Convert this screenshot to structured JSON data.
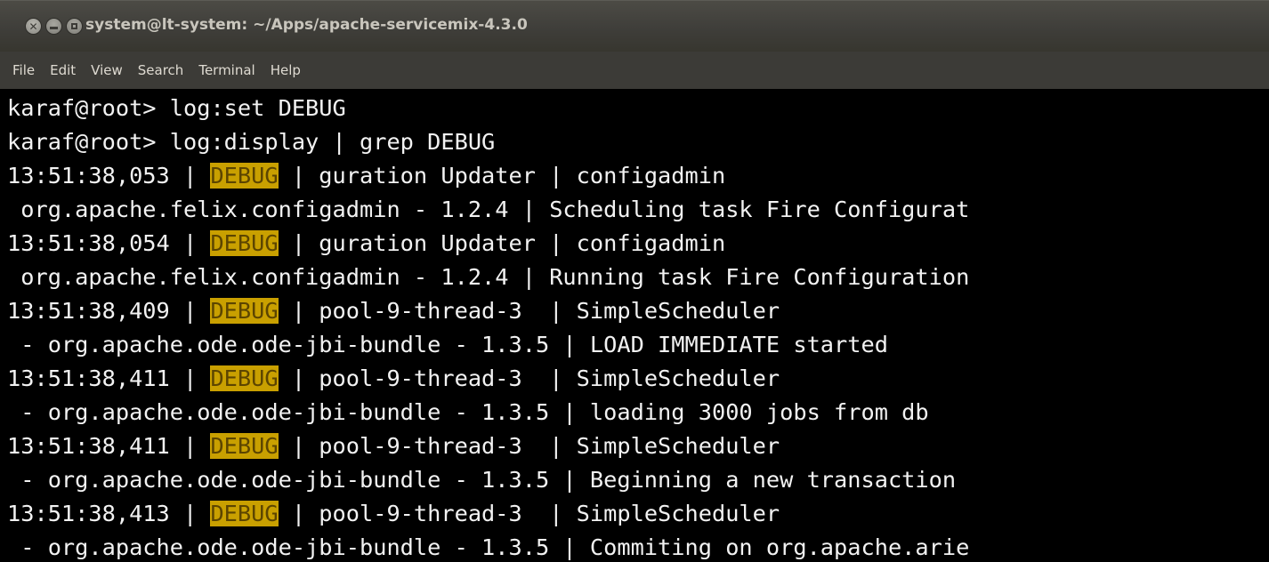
{
  "window": {
    "title": "system@lt-system: ~/Apps/apache-servicemix-4.3.0",
    "buttons": {
      "close_glyph": "✕"
    }
  },
  "menu": {
    "items": [
      "File",
      "Edit",
      "View",
      "Search",
      "Terminal",
      "Help"
    ]
  },
  "terminal": {
    "highlight_color": "#c9a000",
    "lines": [
      {
        "segments": [
          {
            "text": "karaf@root> log:set DEBUG",
            "hl": false
          }
        ]
      },
      {
        "segments": [
          {
            "text": "karaf@root> log:display | grep DEBUG",
            "hl": false
          }
        ]
      },
      {
        "segments": [
          {
            "text": "13:51:38,053 | ",
            "hl": false
          },
          {
            "text": "DEBUG",
            "hl": true
          },
          {
            "text": " | guration Updater | configadmin",
            "hl": false
          }
        ]
      },
      {
        "segments": [
          {
            "text": " org.apache.felix.configadmin - 1.2.4 | Scheduling task Fire Configurat",
            "hl": false
          }
        ]
      },
      {
        "segments": [
          {
            "text": "13:51:38,054 | ",
            "hl": false
          },
          {
            "text": "DEBUG",
            "hl": true
          },
          {
            "text": " | guration Updater | configadmin",
            "hl": false
          }
        ]
      },
      {
        "segments": [
          {
            "text": " org.apache.felix.configadmin - 1.2.4 | Running task Fire Configuration",
            "hl": false
          }
        ]
      },
      {
        "segments": [
          {
            "text": "13:51:38,409 | ",
            "hl": false
          },
          {
            "text": "DEBUG",
            "hl": true
          },
          {
            "text": " | pool-9-thread-3  | SimpleScheduler",
            "hl": false
          }
        ]
      },
      {
        "segments": [
          {
            "text": " - org.apache.ode.ode-jbi-bundle - 1.3.5 | LOAD IMMEDIATE started",
            "hl": false
          }
        ]
      },
      {
        "segments": [
          {
            "text": "13:51:38,411 | ",
            "hl": false
          },
          {
            "text": "DEBUG",
            "hl": true
          },
          {
            "text": " | pool-9-thread-3  | SimpleScheduler",
            "hl": false
          }
        ]
      },
      {
        "segments": [
          {
            "text": " - org.apache.ode.ode-jbi-bundle - 1.3.5 | loading 3000 jobs from db",
            "hl": false
          }
        ]
      },
      {
        "segments": [
          {
            "text": "13:51:38,411 | ",
            "hl": false
          },
          {
            "text": "DEBUG",
            "hl": true
          },
          {
            "text": " | pool-9-thread-3  | SimpleScheduler",
            "hl": false
          }
        ]
      },
      {
        "segments": [
          {
            "text": " - org.apache.ode.ode-jbi-bundle - 1.3.5 | Beginning a new transaction",
            "hl": false
          }
        ]
      },
      {
        "segments": [
          {
            "text": "13:51:38,413 | ",
            "hl": false
          },
          {
            "text": "DEBUG",
            "hl": true
          },
          {
            "text": " | pool-9-thread-3  | SimpleScheduler",
            "hl": false
          }
        ]
      },
      {
        "segments": [
          {
            "text": " - org.apache.ode.ode-jbi-bundle - 1.3.5 | Commiting on org.apache.arie",
            "hl": false
          }
        ]
      }
    ]
  }
}
